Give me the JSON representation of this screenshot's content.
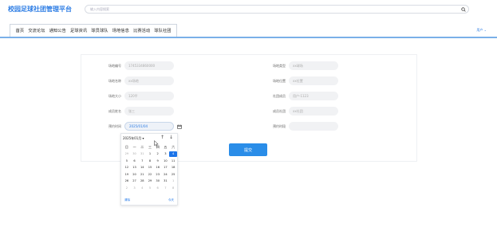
{
  "header": {
    "brand": "校园足球社团管理平台",
    "search_placeholder": "输入内容搜索",
    "search_icon": "search-icon"
  },
  "nav": {
    "items": [
      "首页",
      "交流论坛",
      "通知公告",
      "足球资讯",
      "球员球队",
      "场地信息",
      "比赛活动",
      "球队社团"
    ],
    "user_label": "用户 ⌄"
  },
  "form": {
    "left": [
      {
        "label": "场地编号",
        "value": "1745334860000"
      },
      {
        "label": "场地名称",
        "value": "xx场地"
      },
      {
        "label": "场地大小",
        "value": "120平"
      },
      {
        "label": "成员姓名",
        "value": "张三"
      },
      {
        "label": "预约时间",
        "value": "2025/01/04"
      }
    ],
    "right": [
      {
        "label": "场地类型",
        "value": "xx球场"
      },
      {
        "label": "场地位置",
        "value": "xx位置"
      },
      {
        "label": "社团成员",
        "value": "用户-1123"
      },
      {
        "label": "成员社团",
        "value": "xx社团"
      },
      {
        "label": "预约时段",
        "value": ""
      }
    ],
    "submit_label": "提交"
  },
  "datepicker": {
    "month_label": "2025年01月 ▾",
    "up_arrow": "↑",
    "down_arrow": "↓",
    "weekdays": [
      "日",
      "一",
      "二",
      "三",
      "四",
      "五",
      "六"
    ],
    "days": [
      [
        "29",
        "other"
      ],
      [
        "30",
        "other"
      ],
      [
        "31",
        "other"
      ],
      [
        "1",
        "cur"
      ],
      [
        "2",
        "cur"
      ],
      [
        "3",
        "cur"
      ],
      [
        "4",
        "sel"
      ],
      [
        "5",
        "cur"
      ],
      [
        "6",
        "cur"
      ],
      [
        "7",
        "cur"
      ],
      [
        "8",
        "cur"
      ],
      [
        "9",
        "cur"
      ],
      [
        "10",
        "cur"
      ],
      [
        "11",
        "cur"
      ],
      [
        "12",
        "cur"
      ],
      [
        "13",
        "cur"
      ],
      [
        "14",
        "cur"
      ],
      [
        "15",
        "cur"
      ],
      [
        "16",
        "cur"
      ],
      [
        "17",
        "cur"
      ],
      [
        "18",
        "cur"
      ],
      [
        "19",
        "cur"
      ],
      [
        "20",
        "cur"
      ],
      [
        "21",
        "cur"
      ],
      [
        "22",
        "cur"
      ],
      [
        "23",
        "cur"
      ],
      [
        "24",
        "cur"
      ],
      [
        "25",
        "cur"
      ],
      [
        "26",
        "cur"
      ],
      [
        "27",
        "cur"
      ],
      [
        "28",
        "cur"
      ],
      [
        "29",
        "cur"
      ],
      [
        "30",
        "cur"
      ],
      [
        "31",
        "cur"
      ],
      [
        "1",
        "other"
      ],
      [
        "2",
        "other"
      ],
      [
        "3",
        "other"
      ],
      [
        "4",
        "other"
      ],
      [
        "5",
        "other"
      ],
      [
        "6",
        "other"
      ],
      [
        "7",
        "other"
      ],
      [
        "8",
        "other"
      ]
    ],
    "clear_label": "清除",
    "today_label": "今天"
  },
  "colors": {
    "brand": "#2a7be4",
    "submit": "#2a8de8",
    "selected_day": "#1a73e8",
    "nav_border": "#7ab0e8"
  }
}
